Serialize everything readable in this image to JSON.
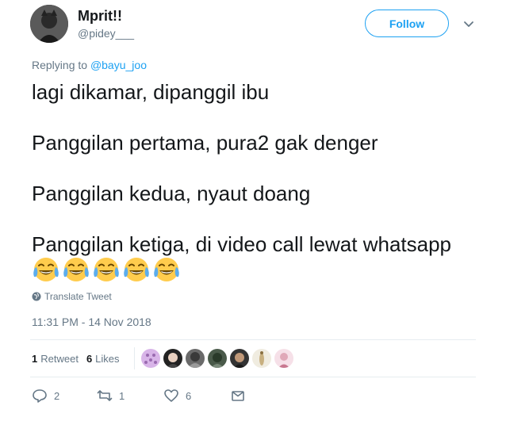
{
  "user": {
    "name": "Mprit!!",
    "handle": "@pidey___"
  },
  "follow_label": "Follow",
  "replying": {
    "prefix": "Replying to",
    "mention": "@bayu_joo"
  },
  "tweet": {
    "lines": [
      "lagi dikamar, dipanggil ibu",
      "Panggilan pertama, pura2 gak denger",
      "Panggilan kedua, nyaut doang",
      "Panggilan ketiga, di video call lewat whatsapp"
    ],
    "emoji_count": 5
  },
  "translate_label": "Translate Tweet",
  "timestamp": "11:31 PM - 14 Nov 2018",
  "stats": {
    "retweets_count": "1",
    "retweets_label": "Retweet",
    "likes_count": "6",
    "likes_label": "Likes"
  },
  "actions": {
    "reply_count": "2",
    "retweet_count": "1",
    "like_count": "6"
  },
  "colors": {
    "accent": "#1da1f2",
    "secondary_text": "#657786",
    "primary_text": "#14171a",
    "divider": "#e6ecf0"
  }
}
